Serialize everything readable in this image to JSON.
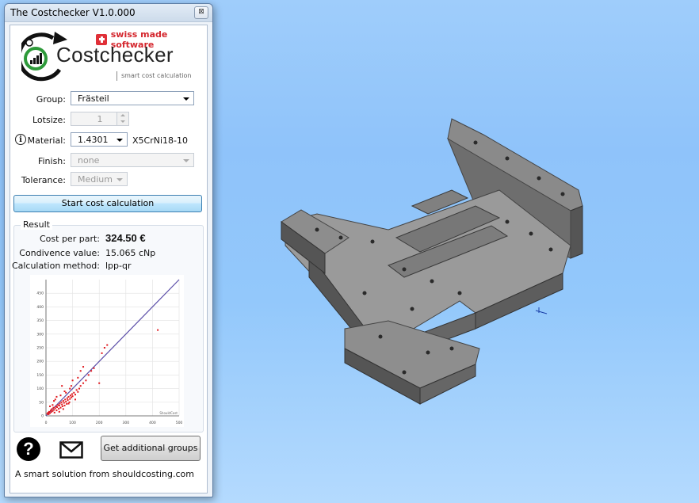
{
  "window": {
    "title": "The Costchecker V1.0.000",
    "close_symbol": "⊠"
  },
  "logo": {
    "swiss_text": "swiss made software",
    "brand": "Costchecker",
    "tagline": "smart cost calculation"
  },
  "form": {
    "group": {
      "label": "Group:",
      "value": "Frästeil"
    },
    "lotsize": {
      "label": "Lotsize:",
      "value": "1"
    },
    "material": {
      "label": "Material:",
      "value": "1.4301",
      "description": "X5CrNi18-10"
    },
    "finish": {
      "label": "Finish:",
      "value": "none"
    },
    "tolerance": {
      "label": "Tolerance:",
      "value": "Medium"
    }
  },
  "start_button": "Start cost calculation",
  "result": {
    "title": "Result",
    "cost_label": "Cost per part:",
    "cost_value": "324.50 €",
    "confidence_label": "Condivence value:",
    "confidence_value": "15.065 cNp",
    "method_label": "Calculation method:",
    "method_value": "lpp-qr"
  },
  "chart_data": {
    "type": "scatter",
    "xlim": [
      0,
      500
    ],
    "ylim": [
      0,
      500
    ],
    "x_ticks": [
      "0",
      "100",
      "200",
      "300",
      "400",
      "500"
    ],
    "y_ticks": [
      "0",
      "50",
      "100",
      "150",
      "200",
      "250",
      "300",
      "350",
      "400",
      "450"
    ],
    "corner_label": "ShouldCost",
    "reference_line": [
      [
        0,
        0
      ],
      [
        500,
        500
      ]
    ],
    "points": [
      [
        5,
        8
      ],
      [
        8,
        12
      ],
      [
        10,
        6
      ],
      [
        12,
        15
      ],
      [
        15,
        10
      ],
      [
        18,
        20
      ],
      [
        20,
        14
      ],
      [
        22,
        25
      ],
      [
        25,
        18
      ],
      [
        28,
        30
      ],
      [
        30,
        22
      ],
      [
        32,
        12
      ],
      [
        35,
        28
      ],
      [
        38,
        35
      ],
      [
        40,
        20
      ],
      [
        42,
        32
      ],
      [
        45,
        40
      ],
      [
        48,
        26
      ],
      [
        50,
        38
      ],
      [
        52,
        45
      ],
      [
        55,
        30
      ],
      [
        58,
        50
      ],
      [
        60,
        42
      ],
      [
        62,
        35
      ],
      [
        65,
        55
      ],
      [
        68,
        48
      ],
      [
        70,
        38
      ],
      [
        72,
        60
      ],
      [
        75,
        52
      ],
      [
        78,
        44
      ],
      [
        80,
        65
      ],
      [
        82,
        58
      ],
      [
        85,
        70
      ],
      [
        88,
        50
      ],
      [
        90,
        62
      ],
      [
        92,
        75
      ],
      [
        95,
        68
      ],
      [
        98,
        80
      ],
      [
        100,
        72
      ],
      [
        105,
        85
      ],
      [
        110,
        78
      ],
      [
        115,
        95
      ],
      [
        120,
        88
      ],
      [
        125,
        100
      ],
      [
        130,
        110
      ],
      [
        140,
        120
      ],
      [
        150,
        130
      ],
      [
        160,
        150
      ],
      [
        170,
        165
      ],
      [
        180,
        175
      ],
      [
        200,
        120
      ],
      [
        210,
        230
      ],
      [
        220,
        250
      ],
      [
        60,
        110
      ],
      [
        70,
        90
      ],
      [
        40,
        70
      ],
      [
        30,
        55
      ],
      [
        25,
        40
      ],
      [
        50,
        15
      ],
      [
        65,
        25
      ],
      [
        85,
        45
      ],
      [
        100,
        130
      ],
      [
        120,
        140
      ],
      [
        90,
        100
      ],
      [
        110,
        60
      ],
      [
        230,
        260
      ],
      [
        420,
        315
      ],
      [
        15,
        35
      ],
      [
        35,
        60
      ],
      [
        55,
        75
      ],
      [
        75,
        85
      ],
      [
        95,
        110
      ],
      [
        130,
        165
      ],
      [
        140,
        180
      ]
    ]
  },
  "bottom": {
    "help_symbol": "?",
    "groups_button": "Get additional groups",
    "footer": "A smart solution from shouldcosting.com"
  }
}
